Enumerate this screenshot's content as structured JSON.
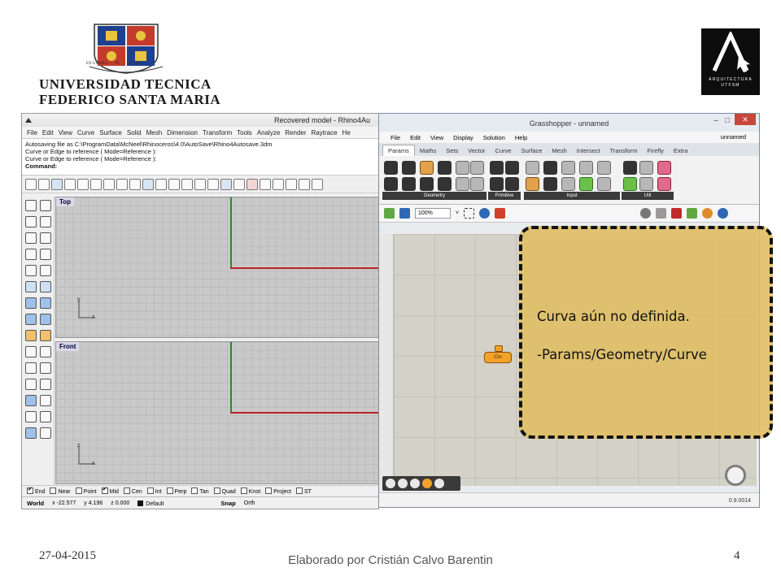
{
  "header": {
    "university_line1": "UNIVERSIDAD TECNICA",
    "university_line2": "FEDERICO SANTA MARIA",
    "crest_motto_left": "EX UMBRA",
    "crest_motto_mid": "IN",
    "crest_motto_right": "SOLEM",
    "arq_logo_letter": "A",
    "arq_logo_line1": "ARQUITECTURA",
    "arq_logo_line2": "UTFSM"
  },
  "rhino": {
    "title": "Recovered model - Rhino4Au",
    "menu": [
      "File",
      "Edit",
      "View",
      "Curve",
      "Surface",
      "Solid",
      "Mesh",
      "Dimension",
      "Transform",
      "Tools",
      "Analyze",
      "Render",
      "Raytrace",
      "He"
    ],
    "command_lines": [
      "Autosaving file as C:\\ProgramData\\McNeel\\Rhinoceros\\4.0\\AutoSave\\Rhino4Autosave.3dm",
      "Curve or Edge to reference ( Mode=Reference ):",
      "Curve or Edge to reference ( Mode=Reference ):"
    ],
    "command_prompt": "Command:",
    "viewport_top": "Top",
    "viewport_front": "Front",
    "axis_top_y": "y",
    "axis_top_x": "x",
    "axis_front_z": "z",
    "axis_front_x": "x",
    "osnaps": [
      {
        "label": "End",
        "checked": true
      },
      {
        "label": "Near",
        "checked": false
      },
      {
        "label": "Point",
        "checked": false
      },
      {
        "label": "Mid",
        "checked": true
      },
      {
        "label": "Cen",
        "checked": false
      },
      {
        "label": "Int",
        "checked": false
      },
      {
        "label": "Perp",
        "checked": false
      },
      {
        "label": "Tan",
        "checked": false
      },
      {
        "label": "Quad",
        "checked": false
      },
      {
        "label": "Knot",
        "checked": false
      },
      {
        "label": "Project",
        "checked": false
      },
      {
        "label": "ST",
        "checked": false
      }
    ],
    "status": {
      "world": "World",
      "x": "x -22.577",
      "y": "y 4.196",
      "z": "z 0.000",
      "layer": "Default",
      "snap": "Snap",
      "ortho": "Orth"
    }
  },
  "grasshopper": {
    "title": "Grasshopper - unnamed",
    "menu": [
      "File",
      "Edit",
      "View",
      "Display",
      "Solution",
      "Help"
    ],
    "doc_name": "unnamed",
    "tabs": [
      "Params",
      "Maths",
      "Sets",
      "Vector",
      "Curve",
      "Surface",
      "Mesh",
      "Intersect",
      "Transform",
      "Firefly",
      "Extra"
    ],
    "active_tab": "Params",
    "ribbon_groups": [
      "Geometry",
      "Primitive",
      "Input",
      "Util"
    ],
    "zoom": "100%",
    "component_label": "Crv",
    "version": "0.9.0014"
  },
  "callout": {
    "line1": "Curva aún no definida.",
    "line2": "-Params/Geometry/Curve"
  },
  "footer": {
    "date": "27-04-2015",
    "author": "Elaborado por Cristián Calvo Barentin",
    "page": "4"
  },
  "colors": {
    "callout_fill": "#e0be64",
    "rhino_axis_green": "#2a8a2a",
    "rhino_axis_red": "#b22222",
    "gh_component": "#f2a12a"
  }
}
